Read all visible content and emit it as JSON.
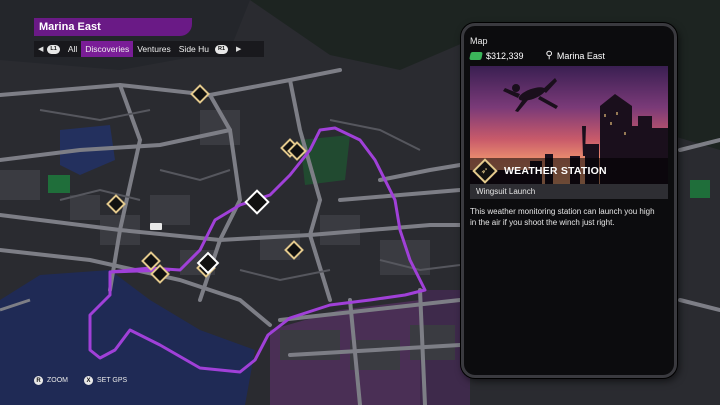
{
  "header": {
    "region": "Marina East",
    "prev_button": "L1",
    "next_button": "R1",
    "tabs": [
      {
        "label": "All",
        "active": false
      },
      {
        "label": "Discoveries",
        "active": true
      },
      {
        "label": "Ventures",
        "active": false
      },
      {
        "label": "Side Hu",
        "active": false
      }
    ]
  },
  "panel": {
    "title": "Map",
    "cash": "$312,339",
    "location": "Marina East",
    "activity_title": "WEATHER STATION",
    "activity_subtitle": "Wingsuit Launch",
    "description": "This weather monitoring station can launch you high in the air if you shoot the winch just right.",
    "icons": {
      "cash": "cash-icon",
      "location": "location-pin-icon",
      "activity": "wingsuit-icon"
    }
  },
  "controls": {
    "zoom": {
      "button": "R",
      "label": "ZOOM"
    },
    "gps": {
      "button": "X",
      "label": "SET GPS"
    }
  },
  "colors": {
    "accent_purple": "#7a1d97",
    "gps_route": "#a040d8",
    "icon_gold": "#e3c98c",
    "water": "#1e2a52",
    "district_purple": "#4a2f55"
  }
}
